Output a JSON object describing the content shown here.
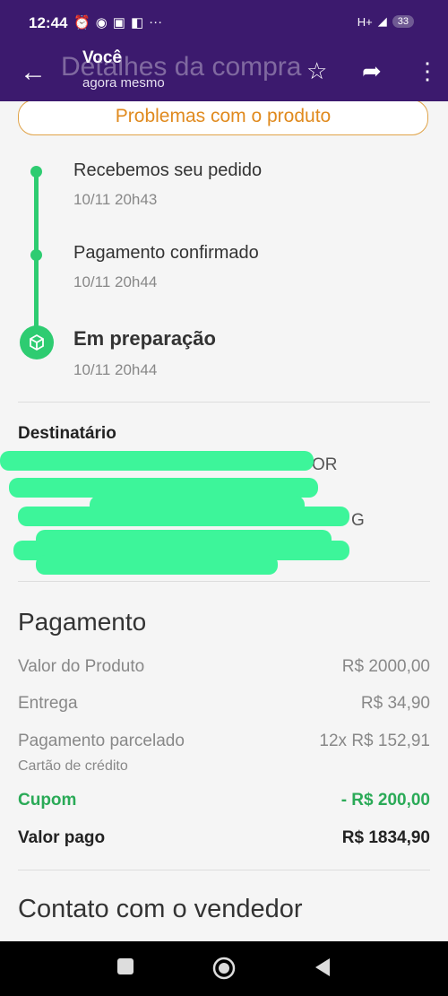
{
  "status": {
    "time": "12:44",
    "network": "H+",
    "battery": "33",
    "more": "···"
  },
  "appbar": {
    "ghost_title": "Detalhes da compra",
    "sender": "Você",
    "subtitle": "agora mesmo"
  },
  "problems_button": "Problemas com o produto",
  "timeline": [
    {
      "label": "Recebemos seu pedido",
      "time": "10/11 20h43"
    },
    {
      "label": "Pagamento confirmado",
      "time": "10/11 20h44"
    },
    {
      "label": "Em preparação",
      "time": "10/11 20h44"
    }
  ],
  "recipient": {
    "title": "Destinatário",
    "lines": [
      "OR",
      "G"
    ]
  },
  "payment": {
    "title": "Pagamento",
    "product_label": "Valor do Produto",
    "product_value": "R$ 2000,00",
    "shipping_label": "Entrega",
    "shipping_value": "R$ 34,90",
    "installments_label": "Pagamento parcelado",
    "installments_value": "12x R$ 152,91",
    "method": "Cartão de crédito",
    "coupon_label": "Cupom",
    "coupon_value": "- R$ 200,00",
    "paid_label": "Valor pago",
    "paid_value": "R$ 1834,90"
  },
  "contact_title": "Contato com o vendedor",
  "colors": {
    "header": "#3c1a6e",
    "accent_orange": "#e08a1e",
    "timeline_green": "#2ecc71",
    "coupon_green": "#2aaa57",
    "redaction": "#3df59a"
  }
}
